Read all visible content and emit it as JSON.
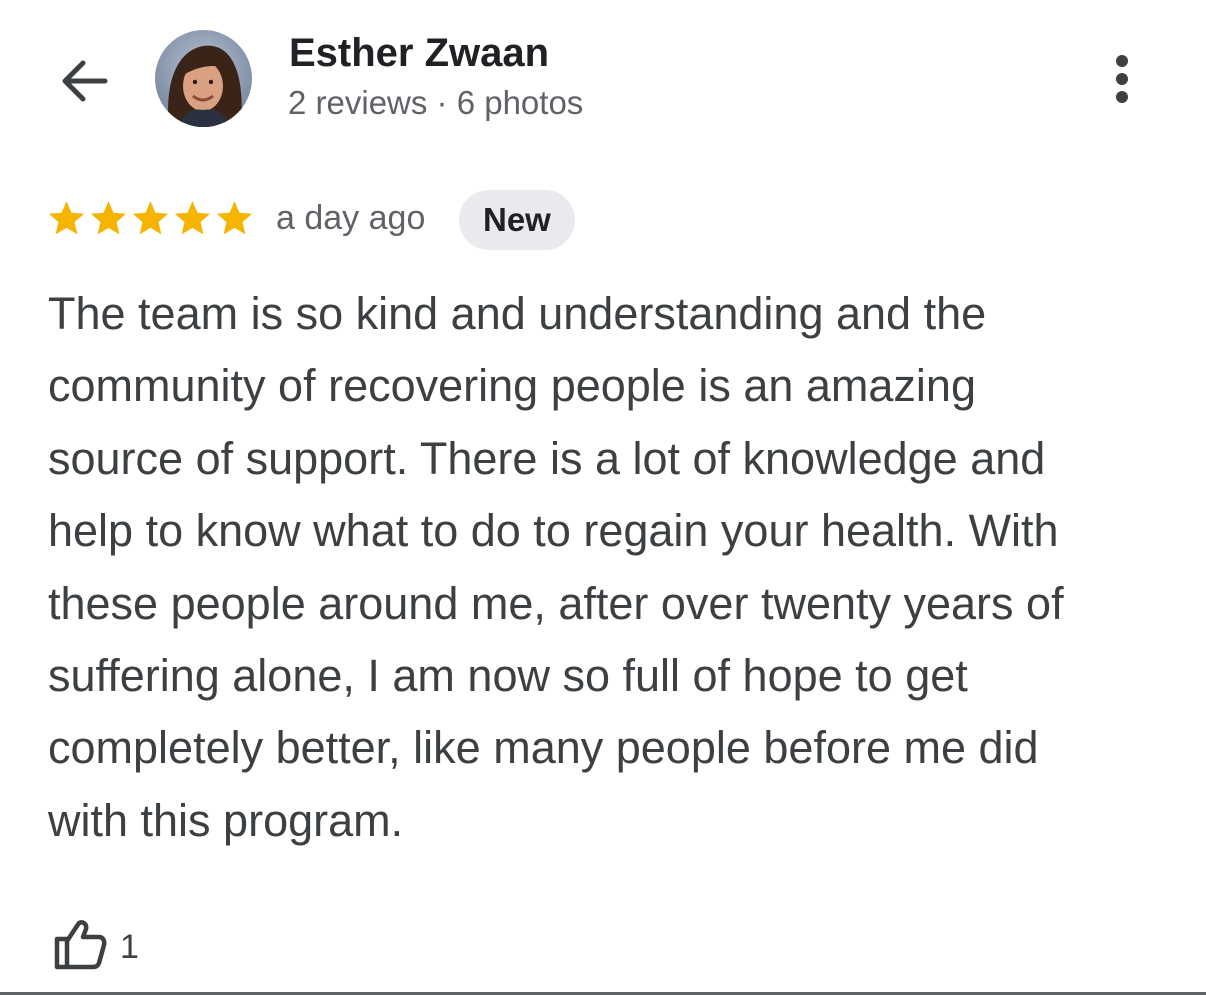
{
  "header": {
    "author_name": "Esther Zwaan",
    "author_meta": "2 reviews · 6 photos",
    "back_icon": "arrow-left-icon",
    "more_icon": "more-vert-icon"
  },
  "review": {
    "rating": 5,
    "rating_max": 5,
    "star_color": "#f4b400",
    "time_ago": "a day ago",
    "badge": "New",
    "lines": [
      "The team is so kind and understanding and the",
      "community of recovering people is an amazing",
      "source of support. There is a lot of knowledge and",
      "help to know what to do to regain your health. With",
      "these people around me, after over twenty years of",
      "suffering alone, I am now so full of hope to get",
      "completely better, like many people before me did",
      "with this program."
    ]
  },
  "actions": {
    "like_icon": "thumbs-up-icon",
    "like_count": "1"
  }
}
